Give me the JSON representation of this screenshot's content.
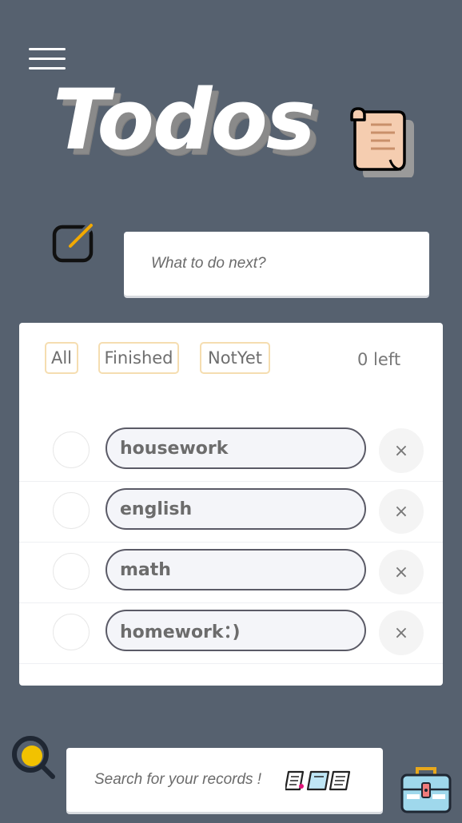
{
  "header": {
    "menu_icon": "hamburger-menu-icon",
    "title": "Todos",
    "title_icon": "scroll-icon"
  },
  "new_todo": {
    "icon": "edit-icon",
    "placeholder": "What to do next?"
  },
  "filters": {
    "all_label": "All",
    "finished_label": "Finished",
    "notyet_label": "NotYet",
    "left_text": "0 left"
  },
  "todos": [
    {
      "text": "housework"
    },
    {
      "text": "english"
    },
    {
      "text": "math"
    },
    {
      "text": "homework：)"
    }
  ],
  "delete_glyph": "×",
  "search": {
    "icon": "search-icon",
    "placeholder": "Search for your records !",
    "books_icon": "books-icon"
  },
  "toolbox_icon": "toolbox-icon",
  "colors": {
    "background": "#56616f",
    "filter_border": "#f5ddb0",
    "accent_yellow": "#f2c200",
    "scroll_fill": "#f5cdb0"
  }
}
